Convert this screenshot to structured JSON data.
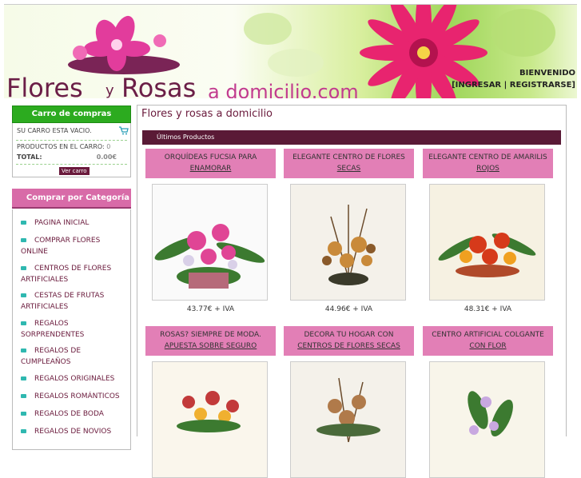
{
  "header": {
    "logo_flores": "Flores",
    "logo_y": "y",
    "logo_rosas": "Rosas",
    "logo_adomicilio": "a domicilio.com",
    "welcome": "BIENVENIDO",
    "login": "[INGRESAR",
    "register": "REGISTRARSE]"
  },
  "cart": {
    "title": "Carro de compras",
    "empty": "SU CARRO ESTA VACIO.",
    "products_label": "PRODUCTOS EN EL CARRO:",
    "products_count": "0",
    "total_label": "TOTAL:",
    "total_value": "0.00€",
    "view_button": "Ver carro"
  },
  "categories": {
    "title": "Comprar por Categoría",
    "items": [
      "PAGINA INICIAL",
      "COMPRAR FLORES ONLINE",
      "CENTROS DE FLORES ARTIFICIALES",
      "CESTAS DE FRUTAS ARTIFICIALES",
      "REGALOS SORPRENDENTES",
      "REGALOS DE CUMPLEAÑOS",
      "REGALOS ORIGINALES",
      "REGALOS ROMÁNTICOS",
      "REGALOS DE BODA",
      "REGALOS DE NOVIOS"
    ]
  },
  "main": {
    "title": "Flores y rosas a domicilio",
    "section": "Últimos Productos",
    "products": [
      {
        "line1": "ORQUÍDEAS FUCSIA PARA",
        "line2": "ENAMORAR",
        "price": "43.77€ + IVA"
      },
      {
        "line1": "ELEGANTE CENTRO DE FLORES",
        "line2": "SECAS",
        "price": "44.96€ + IVA"
      },
      {
        "line1": "ELEGANTE CENTRO DE AMARILIS",
        "line2": "ROJOS",
        "price": "48.31€ + IVA"
      },
      {
        "line1": "ROSAS? SIEMPRE DE MODA.",
        "line2": "APUESTA SOBRE SEGURO",
        "price": ""
      },
      {
        "line1": "DECORA TU HOGAR CON",
        "line2": "CENTROS DE FLORES SECAS",
        "price": ""
      },
      {
        "line1": "CENTRO ARTIFICIAL COLGANTE",
        "line2": "CON FLOR",
        "price": ""
      }
    ]
  },
  "colors": {
    "accent_pink": "#e27fb6",
    "dark_plum": "#5a1a36",
    "green": "#2cab1f"
  }
}
